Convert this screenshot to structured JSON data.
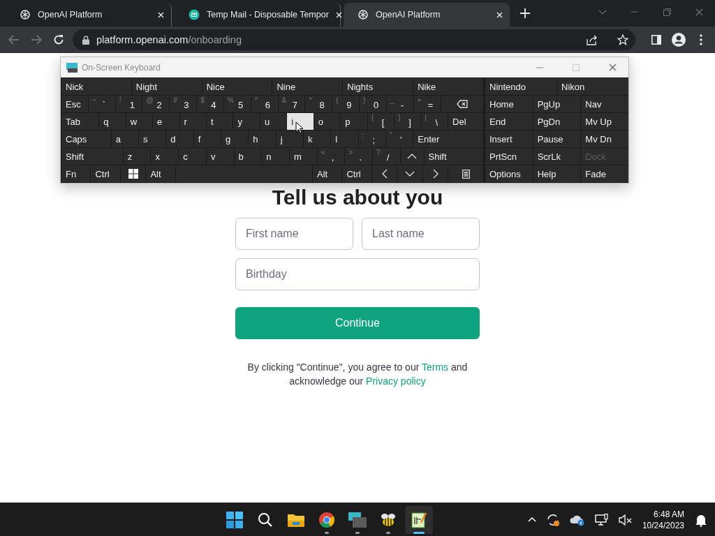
{
  "browser": {
    "tabs": [
      {
        "title": "OpenAI Platform",
        "kind": "openai",
        "selected": false
      },
      {
        "title": "Temp Mail - Disposable Tempor",
        "kind": "tempmail",
        "selected": false
      },
      {
        "title": "OpenAI Platform",
        "kind": "openai",
        "selected": true
      }
    ],
    "host": "platform.openai.com",
    "path": "/onboarding"
  },
  "page": {
    "heading": "Tell us about you",
    "fields": [
      {
        "placeholder": "First name"
      },
      {
        "placeholder": "Last name"
      },
      {
        "placeholder": "Birthday"
      }
    ],
    "button": "Continue",
    "legal": {
      "before": "By clicking \"Continue\", you agree to our",
      "terms": "Terms",
      "middle": "and",
      "line2": "acknowledge our",
      "privacy": "Privacy policy"
    }
  },
  "osk": {
    "title": "On-Screen Keyboard",
    "left_suggestions": [
      "Nick",
      "Night",
      "Nice",
      "Nine",
      "Nights",
      "Nike"
    ],
    "right_suggestions": [
      "Nintendo",
      "Nikon"
    ],
    "key_rows": [
      {
        "keys": [
          {
            "label": "Esc",
            "pressed": false
          },
          {
            "label": "`",
            "shift": "~",
            "pressed": false
          },
          {
            "label": "1",
            "shift": "!",
            "pressed": false
          },
          {
            "label": "2",
            "shift": "@",
            "pressed": false
          },
          {
            "label": "3",
            "shift": "#",
            "pressed": false
          },
          {
            "label": "4",
            "shift": "$",
            "pressed": false
          },
          {
            "label": "5",
            "shift": "%",
            "pressed": false
          },
          {
            "label": "6",
            "shift": "^",
            "pressed": false
          },
          {
            "label": "7",
            "shift": "&",
            "pressed": false
          },
          {
            "label": "8",
            "shift": "*",
            "pressed": false
          },
          {
            "label": "9",
            "shift": "(",
            "pressed": false
          },
          {
            "label": "0",
            "shift": ")",
            "pressed": false
          },
          {
            "label": "-",
            "shift": "_",
            "pressed": false
          },
          {
            "label": "=",
            "shift": "+",
            "pressed": false
          },
          {
            "kind": "backspace",
            "pressed": false
          }
        ]
      },
      {
        "keys": [
          {
            "label": "Tab",
            "pressed": false
          },
          {
            "label": "q",
            "pressed": false
          },
          {
            "label": "w",
            "pressed": false
          },
          {
            "label": "e",
            "pressed": false
          },
          {
            "label": "r",
            "pressed": false
          },
          {
            "label": "t",
            "pressed": false
          },
          {
            "label": "y",
            "pressed": false
          },
          {
            "label": "u",
            "pressed": false
          },
          {
            "label": "i",
            "pressed": true
          },
          {
            "label": "o",
            "pressed": false
          },
          {
            "label": "p",
            "pressed": false
          },
          {
            "label": "[",
            "shift": "{",
            "pressed": false
          },
          {
            "label": "]",
            "shift": "}",
            "pressed": false
          },
          {
            "label": "\\",
            "shift": "|",
            "pressed": false
          },
          {
            "label": "Del",
            "pressed": false
          }
        ]
      },
      {
        "keys": [
          {
            "label": "Caps",
            "pressed": false
          },
          {
            "label": "a",
            "pressed": false
          },
          {
            "label": "s",
            "pressed": false
          },
          {
            "label": "d",
            "pressed": false
          },
          {
            "label": "f",
            "pressed": false
          },
          {
            "label": "g",
            "pressed": false
          },
          {
            "label": "h",
            "pressed": false
          },
          {
            "label": "j",
            "pressed": false
          },
          {
            "label": "k",
            "pressed": false
          },
          {
            "label": "l",
            "pressed": false
          },
          {
            "label": ";",
            "shift": ":",
            "pressed": false
          },
          {
            "label": "'",
            "shift": "\"",
            "pressed": false
          },
          {
            "label": "Enter",
            "pressed": false
          }
        ]
      },
      {
        "keys": [
          {
            "label": "Shift",
            "pressed": false
          },
          {
            "label": "z",
            "pressed": false
          },
          {
            "label": "x",
            "pressed": false
          },
          {
            "label": "c",
            "pressed": false
          },
          {
            "label": "v",
            "pressed": false
          },
          {
            "label": "b",
            "pressed": false
          },
          {
            "label": "n",
            "pressed": false
          },
          {
            "label": "m",
            "pressed": false
          },
          {
            "label": ",",
            "shift": "<",
            "pressed": false
          },
          {
            "label": ".",
            "shift": ">",
            "pressed": false
          },
          {
            "label": "/",
            "shift": "?",
            "pressed": false
          },
          {
            "kind": "up",
            "pressed": false
          },
          {
            "label": "Shift",
            "pressed": false
          }
        ]
      },
      {
        "keys": [
          {
            "label": "Fn",
            "pressed": false
          },
          {
            "label": "Ctrl",
            "pressed": false
          },
          {
            "kind": "windows",
            "pressed": false
          },
          {
            "label": "Alt",
            "pressed": false
          },
          {
            "kind": "space",
            "pressed": false
          },
          {
            "label": "Alt",
            "pressed": false
          },
          {
            "label": "Ctrl",
            "pressed": false
          },
          {
            "kind": "left",
            "pressed": false
          },
          {
            "kind": "down",
            "pressed": false
          },
          {
            "kind": "right",
            "pressed": false
          },
          {
            "kind": "menu",
            "pressed": false
          }
        ]
      }
    ],
    "nav_rows": [
      [
        {
          "label": "Home",
          "disabled": false
        },
        {
          "label": "PgUp",
          "disabled": false
        },
        {
          "label": "Nav",
          "disabled": false
        }
      ],
      [
        {
          "label": "End",
          "disabled": false
        },
        {
          "label": "PgDn",
          "disabled": false
        },
        {
          "label": "Mv Up",
          "disabled": false
        }
      ],
      [
        {
          "label": "Insert",
          "disabled": false
        },
        {
          "label": "Pause",
          "disabled": false
        },
        {
          "label": "Mv Dn",
          "disabled": false
        }
      ],
      [
        {
          "label": "PrtScn",
          "disabled": false
        },
        {
          "label": "ScrLk",
          "disabled": false
        },
        {
          "label": "Dock",
          "disabled": true
        }
      ],
      [
        {
          "label": "Options",
          "disabled": false
        },
        {
          "label": "Help",
          "disabled": false
        },
        {
          "label": "Fade",
          "disabled": false
        }
      ]
    ]
  },
  "taskbar": {
    "apps": [
      {
        "kind": "start",
        "open": false,
        "selected": false
      },
      {
        "kind": "search",
        "open": false,
        "selected": false
      },
      {
        "kind": "explorer",
        "open": false,
        "selected": false
      },
      {
        "kind": "chrome",
        "open": true,
        "selected": false
      },
      {
        "kind": "keyboard",
        "open": true,
        "selected": false
      },
      {
        "kind": "bee",
        "open": true,
        "selected": false
      },
      {
        "kind": "editor",
        "open": true,
        "selected": true
      }
    ],
    "time": "6:48 AM",
    "date": "10/24/2023"
  }
}
